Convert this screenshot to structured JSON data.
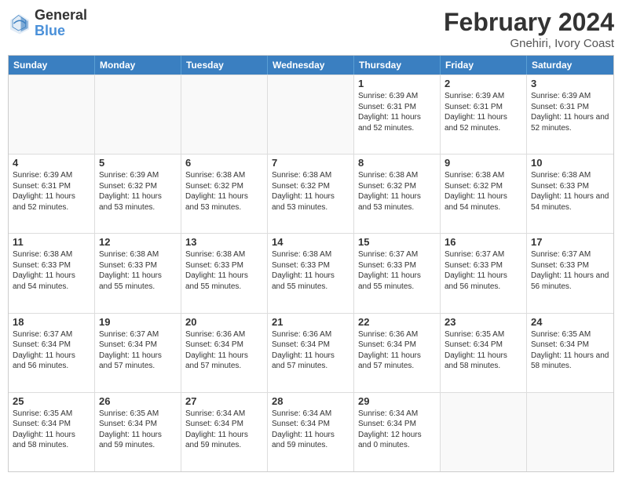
{
  "header": {
    "logo_general": "General",
    "logo_blue": "Blue",
    "title": "February 2024",
    "subtitle": "Gnehiri, Ivory Coast"
  },
  "days_of_week": [
    "Sunday",
    "Monday",
    "Tuesday",
    "Wednesday",
    "Thursday",
    "Friday",
    "Saturday"
  ],
  "weeks": [
    [
      {
        "day": "",
        "info": ""
      },
      {
        "day": "",
        "info": ""
      },
      {
        "day": "",
        "info": ""
      },
      {
        "day": "",
        "info": ""
      },
      {
        "day": "1",
        "info": "Sunrise: 6:39 AM\nSunset: 6:31 PM\nDaylight: 11 hours\nand 52 minutes."
      },
      {
        "day": "2",
        "info": "Sunrise: 6:39 AM\nSunset: 6:31 PM\nDaylight: 11 hours\nand 52 minutes."
      },
      {
        "day": "3",
        "info": "Sunrise: 6:39 AM\nSunset: 6:31 PM\nDaylight: 11 hours\nand 52 minutes."
      }
    ],
    [
      {
        "day": "4",
        "info": "Sunrise: 6:39 AM\nSunset: 6:31 PM\nDaylight: 11 hours\nand 52 minutes."
      },
      {
        "day": "5",
        "info": "Sunrise: 6:39 AM\nSunset: 6:32 PM\nDaylight: 11 hours\nand 53 minutes."
      },
      {
        "day": "6",
        "info": "Sunrise: 6:38 AM\nSunset: 6:32 PM\nDaylight: 11 hours\nand 53 minutes."
      },
      {
        "day": "7",
        "info": "Sunrise: 6:38 AM\nSunset: 6:32 PM\nDaylight: 11 hours\nand 53 minutes."
      },
      {
        "day": "8",
        "info": "Sunrise: 6:38 AM\nSunset: 6:32 PM\nDaylight: 11 hours\nand 53 minutes."
      },
      {
        "day": "9",
        "info": "Sunrise: 6:38 AM\nSunset: 6:32 PM\nDaylight: 11 hours\nand 54 minutes."
      },
      {
        "day": "10",
        "info": "Sunrise: 6:38 AM\nSunset: 6:33 PM\nDaylight: 11 hours\nand 54 minutes."
      }
    ],
    [
      {
        "day": "11",
        "info": "Sunrise: 6:38 AM\nSunset: 6:33 PM\nDaylight: 11 hours\nand 54 minutes."
      },
      {
        "day": "12",
        "info": "Sunrise: 6:38 AM\nSunset: 6:33 PM\nDaylight: 11 hours\nand 55 minutes."
      },
      {
        "day": "13",
        "info": "Sunrise: 6:38 AM\nSunset: 6:33 PM\nDaylight: 11 hours\nand 55 minutes."
      },
      {
        "day": "14",
        "info": "Sunrise: 6:38 AM\nSunset: 6:33 PM\nDaylight: 11 hours\nand 55 minutes."
      },
      {
        "day": "15",
        "info": "Sunrise: 6:37 AM\nSunset: 6:33 PM\nDaylight: 11 hours\nand 55 minutes."
      },
      {
        "day": "16",
        "info": "Sunrise: 6:37 AM\nSunset: 6:33 PM\nDaylight: 11 hours\nand 56 minutes."
      },
      {
        "day": "17",
        "info": "Sunrise: 6:37 AM\nSunset: 6:33 PM\nDaylight: 11 hours\nand 56 minutes."
      }
    ],
    [
      {
        "day": "18",
        "info": "Sunrise: 6:37 AM\nSunset: 6:34 PM\nDaylight: 11 hours\nand 56 minutes."
      },
      {
        "day": "19",
        "info": "Sunrise: 6:37 AM\nSunset: 6:34 PM\nDaylight: 11 hours\nand 57 minutes."
      },
      {
        "day": "20",
        "info": "Sunrise: 6:36 AM\nSunset: 6:34 PM\nDaylight: 11 hours\nand 57 minutes."
      },
      {
        "day": "21",
        "info": "Sunrise: 6:36 AM\nSunset: 6:34 PM\nDaylight: 11 hours\nand 57 minutes."
      },
      {
        "day": "22",
        "info": "Sunrise: 6:36 AM\nSunset: 6:34 PM\nDaylight: 11 hours\nand 57 minutes."
      },
      {
        "day": "23",
        "info": "Sunrise: 6:35 AM\nSunset: 6:34 PM\nDaylight: 11 hours\nand 58 minutes."
      },
      {
        "day": "24",
        "info": "Sunrise: 6:35 AM\nSunset: 6:34 PM\nDaylight: 11 hours\nand 58 minutes."
      }
    ],
    [
      {
        "day": "25",
        "info": "Sunrise: 6:35 AM\nSunset: 6:34 PM\nDaylight: 11 hours\nand 58 minutes."
      },
      {
        "day": "26",
        "info": "Sunrise: 6:35 AM\nSunset: 6:34 PM\nDaylight: 11 hours\nand 59 minutes."
      },
      {
        "day": "27",
        "info": "Sunrise: 6:34 AM\nSunset: 6:34 PM\nDaylight: 11 hours\nand 59 minutes."
      },
      {
        "day": "28",
        "info": "Sunrise: 6:34 AM\nSunset: 6:34 PM\nDaylight: 11 hours\nand 59 minutes."
      },
      {
        "day": "29",
        "info": "Sunrise: 6:34 AM\nSunset: 6:34 PM\nDaylight: 12 hours\nand 0 minutes."
      },
      {
        "day": "",
        "info": ""
      },
      {
        "day": "",
        "info": ""
      }
    ]
  ]
}
